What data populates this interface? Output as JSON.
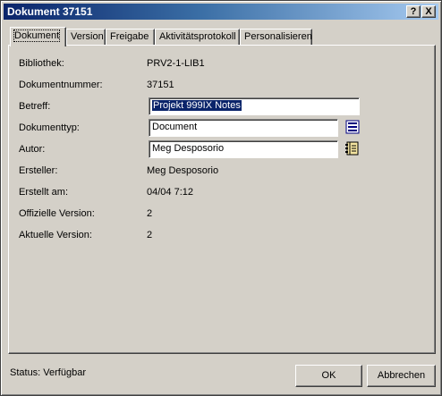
{
  "window": {
    "title": "Dokument 37151"
  },
  "titlebar_buttons": {
    "help": "?",
    "close": "X"
  },
  "tabs": [
    {
      "label": "Dokument"
    },
    {
      "label": "Version"
    },
    {
      "label": "Freigabe"
    },
    {
      "label": "Aktivitätsprotokoll"
    },
    {
      "label": "Personalisieren"
    }
  ],
  "fields": {
    "bibliothek": {
      "label": "Bibliothek:",
      "value": "PRV2-1-LIB1"
    },
    "dokumentnummer": {
      "label": "Dokumentnummer:",
      "value": "37151"
    },
    "betreff": {
      "label": "Betreff:",
      "value": "Projekt 999IX Notes"
    },
    "dokumenttyp": {
      "label": "Dokumenttyp:",
      "value": "Document"
    },
    "autor": {
      "label": "Autor:",
      "value": "Meg Desposorio"
    },
    "ersteller": {
      "label": "Ersteller:",
      "value": "Meg Desposorio"
    },
    "erstellt_am": {
      "label": "Erstellt am:",
      "value": "04/04 7:12"
    },
    "offizielle_version": {
      "label": "Offizielle Version:",
      "value": "2"
    },
    "aktuelle_version": {
      "label": "Aktuelle Version:",
      "value": "2"
    }
  },
  "status": "Status: Verfügbar",
  "buttons": {
    "ok": "OK",
    "cancel": "Abbrechen"
  },
  "icons": {
    "dokumenttyp_lookup": "list-icon",
    "autor_lookup": "address-book-icon"
  }
}
